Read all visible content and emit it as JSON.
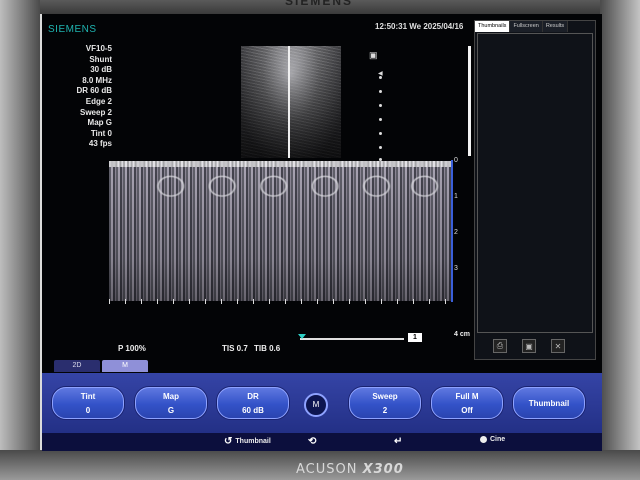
{
  "device": {
    "brand_top": "SIEMENS",
    "model_light": "ACUSON",
    "model_bold": "X300"
  },
  "screen": {
    "brand": "SIEMENS",
    "clock": "12:50:31  We  2025/04/16",
    "params": [
      "VF10-5",
      "Shunt",
      "30 dB",
      "8.0 MHz",
      "DR 60 dB",
      "Edge 2",
      "Sweep 2",
      "Map G",
      "Tint 0",
      "43 fps"
    ],
    "status": {
      "power": "P 100%",
      "tis": "TIS 0.7",
      "tib": "TIB 0.6",
      "slider_value": "1",
      "depth": "4 cm"
    },
    "depth_ticks": [
      "0",
      "1",
      "2",
      "3"
    ],
    "panel_tabs": [
      "Thumbnails",
      "Fullscreen",
      "Results"
    ],
    "mode_tabs": [
      "2D",
      "M"
    ],
    "softkeys": [
      {
        "title": "Tint",
        "value": "0"
      },
      {
        "title": "Map",
        "value": "G"
      },
      {
        "title": "DR",
        "value": "60 dB"
      },
      {
        "title": "Sweep",
        "value": "2"
      },
      {
        "title": "Full M",
        "value": "Off"
      },
      {
        "title": "Thumbnail",
        "value": ""
      }
    ],
    "center_key": "M",
    "bottom": {
      "thumbnail": "Thumbnail",
      "cine": "Cine"
    }
  },
  "icons": {
    "rotate": "rotate-icon",
    "cycle": "cycle-icon",
    "return": "return-icon",
    "panel": [
      "print-icon",
      "save-icon",
      "delete-icon"
    ]
  }
}
